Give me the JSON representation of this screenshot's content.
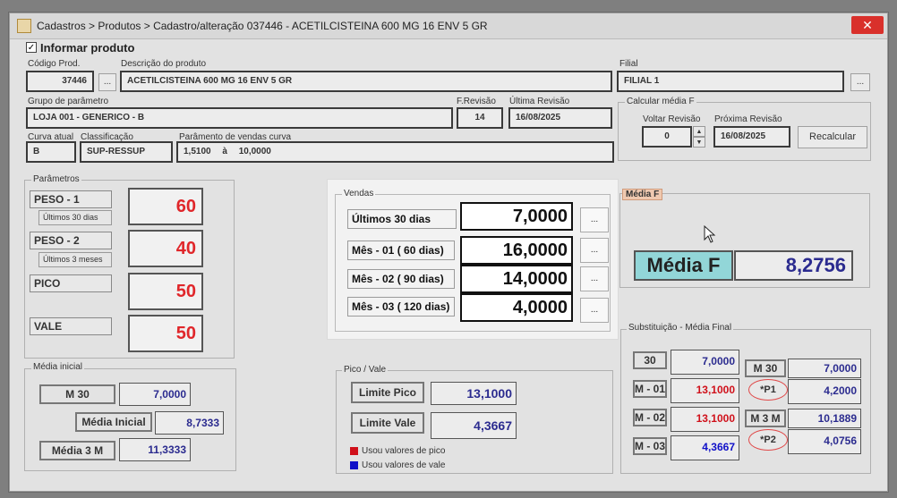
{
  "window": {
    "title": "Cadastros > Produtos > Cadastro/alteração  037446 - ACETILCISTEINA 600 MG 16 ENV 5 GR",
    "close_label": "✕"
  },
  "informar": {
    "label": "Informar produto",
    "checked": true
  },
  "fields": {
    "codigo": {
      "label": "Código Prod.",
      "value": "37446"
    },
    "descricao": {
      "label": "Descrição do  produto",
      "value": "ACETILCISTEINA 600 MG 16 ENV 5 GR"
    },
    "filial": {
      "label": "Filial",
      "value": "FILIAL 1"
    },
    "grupo": {
      "label": "Grupo de parâmetro",
      "value": "LOJA 001 - GENERICO - B"
    },
    "frevisao": {
      "label": "F.Revisão",
      "value": "14"
    },
    "ultima": {
      "label": "Última Revisão",
      "value": "16/08/2025"
    },
    "curva": {
      "label": "Curva atual",
      "value": "B"
    },
    "classificacao": {
      "label": "Classificação",
      "value": "SUP-RESSUP"
    },
    "parametro": {
      "label": "Parâmento de vendas curva",
      "from": "1,5100",
      "sep": "à",
      "to": "10,0000"
    }
  },
  "dots_label": "...",
  "calcular": {
    "title": "Calcular média F",
    "voltar_label": "Voltar Revisão",
    "voltar_value": "0",
    "proxima_label": "Próxima Revisão",
    "proxima_value": "16/08/2025",
    "recalcular": "Recalcular",
    "spin_up": "▲",
    "spin_down": "▼"
  },
  "parametros": {
    "title": "Parâmetros",
    "items": [
      {
        "label": "PESO - 1",
        "sub": "Últimos 30 dias",
        "value": "60"
      },
      {
        "label": "PESO - 2",
        "sub": "Últimos 3 meses",
        "value": "40"
      },
      {
        "label": "PICO",
        "sub": "",
        "value": "50"
      },
      {
        "label": "VALE",
        "sub": "",
        "value": "50"
      }
    ]
  },
  "vendas": {
    "title": "Vendas",
    "rows": [
      {
        "label": "Últimos 30 dias",
        "value": "7,0000"
      },
      {
        "label": "Mês - 01 ( 60 dias)",
        "value": "16,0000"
      },
      {
        "label": "Mês - 02 ( 90 dias)",
        "value": "14,0000"
      },
      {
        "label": "Mês - 03 ( 120 dias)",
        "value": "4,0000"
      }
    ]
  },
  "media_f": {
    "title": "Média F",
    "label": "Média F",
    "value": "8,2756"
  },
  "media_inicial": {
    "title": "Média inicial",
    "m30_label": "M 30",
    "m30_value": "7,0000",
    "inicial_label": "Média Inicial",
    "inicial_value": "8,7333",
    "m3m_label": "Média 3 M",
    "m3m_value": "11,3333"
  },
  "pico_vale": {
    "title": "Pico / Vale",
    "limite_pico_label": "Limite Pico",
    "limite_pico_value": "13,1000",
    "limite_vale_label": "Limite Vale",
    "limite_vale_value": "4,3667",
    "legend_pico": "Usou valores de pico",
    "legend_vale": "Usou valores de vale",
    "pico_color": "#d0101a",
    "vale_color": "#1010c8"
  },
  "substituicao": {
    "title": "Substituição - Média Final",
    "left": [
      {
        "label": "30",
        "value": "7,0000",
        "color": "#2b2b8f"
      },
      {
        "label": "M - 01",
        "value": "13,1000",
        "color": "#d0101a"
      },
      {
        "label": "M - 02",
        "value": "13,1000",
        "color": "#d0101a"
      },
      {
        "label": "M - 03",
        "value": "4,3667",
        "color": "#1010c8"
      }
    ],
    "right": [
      {
        "label": "M 30",
        "value": "7,0000"
      },
      {
        "label": "*P1",
        "value": "4,2000"
      },
      {
        "label": "M 3 M",
        "value": "10,1889"
      },
      {
        "label": "*P2",
        "value": "4,0756"
      }
    ]
  }
}
